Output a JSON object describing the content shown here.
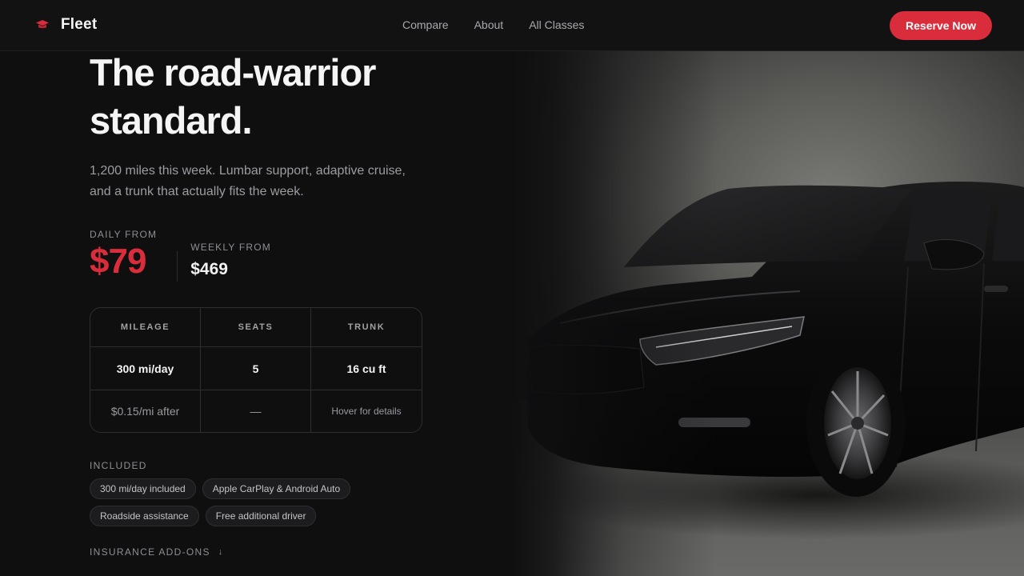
{
  "nav": {
    "brand": "Fleet",
    "brand_icon": "cap-icon",
    "links": [
      "Compare",
      "About",
      "All Classes"
    ],
    "cta": "Reserve Now"
  },
  "hero": {
    "headline": "The road-warrior standard.",
    "subtitle": "1,200 miles this week. Lumbar support, adaptive cruise, and a trunk that actually fits the week."
  },
  "pricing": {
    "daily_label": "DAILY FROM",
    "daily_price": "$79",
    "weekly_label": "WEEKLY FROM",
    "weekly_price": "$469"
  },
  "specs": {
    "headers": [
      "MILEAGE",
      "SEATS",
      "TRUNK"
    ],
    "values": [
      "300 mi/day",
      "5",
      "16 cu ft"
    ],
    "notes": [
      "$0.15/mi after",
      "—",
      "Hover for details"
    ]
  },
  "included": {
    "label": "INCLUDED",
    "chips": [
      "300 mi/day included",
      "Apple CarPlay & Android Auto",
      "Roadside assistance",
      "Free additional driver"
    ]
  },
  "addons": {
    "label": "INSURANCE ADD-ONS",
    "arrow": "↓"
  },
  "colors": {
    "accent": "#d92d3c",
    "background": "#0f0f10"
  }
}
